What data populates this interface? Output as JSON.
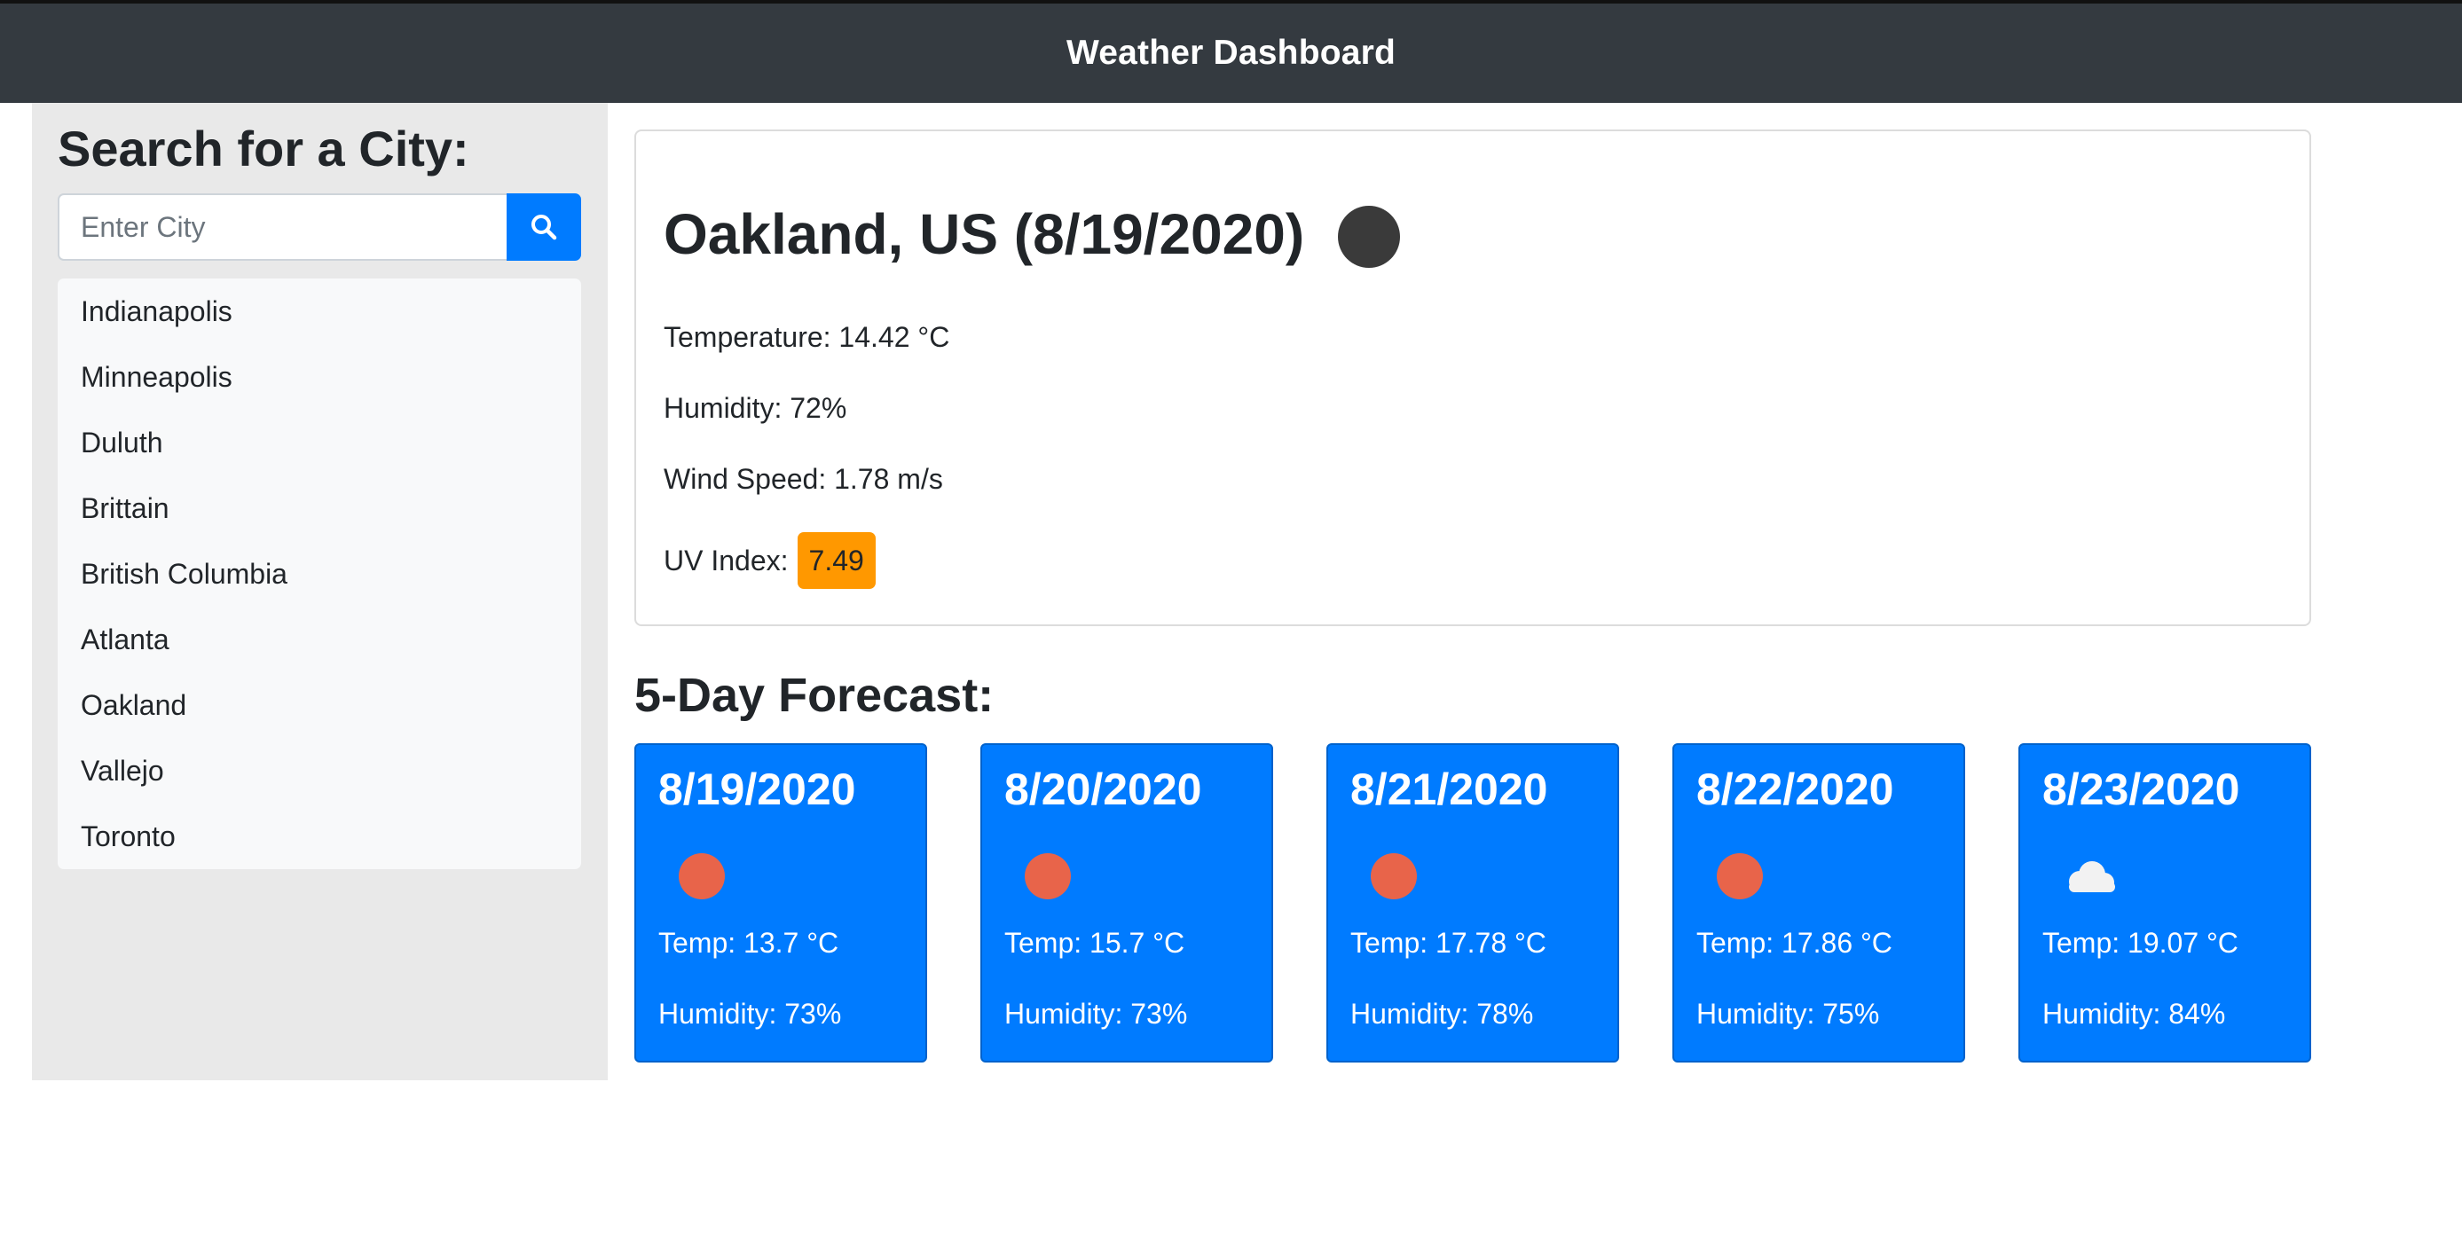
{
  "header": {
    "title": "Weather Dashboard"
  },
  "sidebar": {
    "heading": "Search for a City:",
    "search": {
      "placeholder": "Enter City",
      "value": "",
      "button_icon": "search-icon"
    },
    "cities": [
      "Indianapolis",
      "Minneapolis",
      "Duluth",
      "Brittain",
      "British Columbia",
      "Atlanta",
      "Oakland",
      "Vallejo",
      "Toronto"
    ]
  },
  "current": {
    "title": "Oakland, US (8/19/2020)",
    "icon": "dark-circle-weather-icon",
    "temperature": "Temperature: 14.42 °C",
    "humidity": "Humidity: 72%",
    "wind": "Wind Speed: 1.78 m/s",
    "uv_label": "UV Index:",
    "uv_value": "7.49",
    "uv_color": "#ff9800"
  },
  "forecast": {
    "title": "5-Day Forecast:",
    "card_color": "#007bff",
    "days": [
      {
        "date": "8/19/2020",
        "icon": "sun-icon",
        "temp": "Temp: 13.7 °C",
        "humidity": "Humidity: 73%"
      },
      {
        "date": "8/20/2020",
        "icon": "sun-icon",
        "temp": "Temp: 15.7 °C",
        "humidity": "Humidity: 73%"
      },
      {
        "date": "8/21/2020",
        "icon": "sun-icon",
        "temp": "Temp: 17.78 °C",
        "humidity": "Humidity: 78%"
      },
      {
        "date": "8/22/2020",
        "icon": "sun-icon",
        "temp": "Temp: 17.86 °C",
        "humidity": "Humidity: 75%"
      },
      {
        "date": "8/23/2020",
        "icon": "cloud-icon",
        "temp": "Temp: 19.07 °C",
        "humidity": "Humidity: 84%"
      }
    ]
  }
}
